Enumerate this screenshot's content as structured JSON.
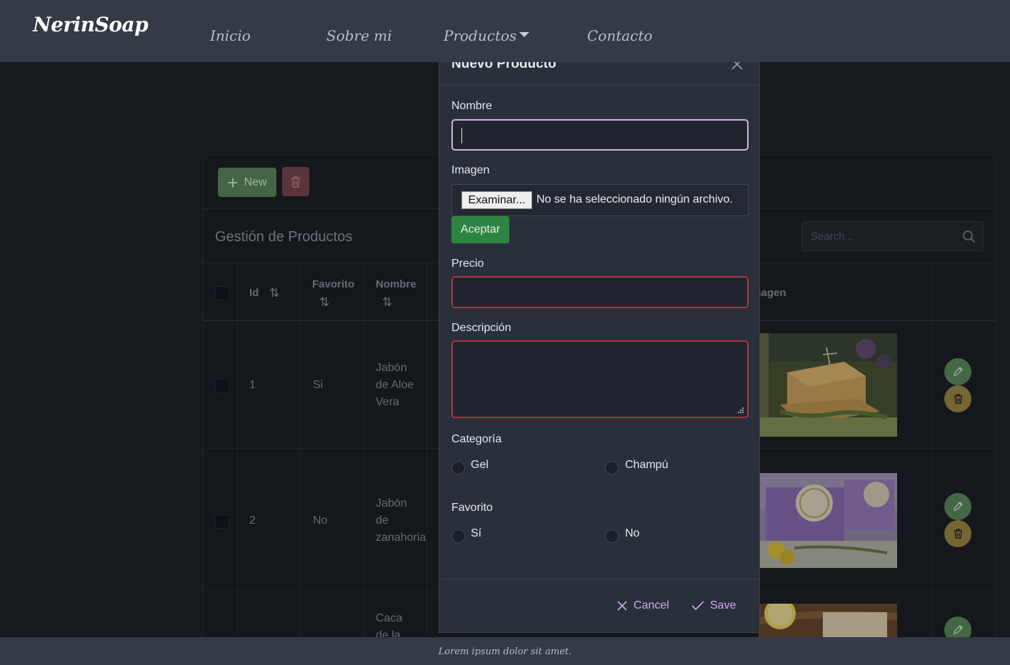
{
  "navbar": {
    "brand": "NerinSoap",
    "items": [
      "Inicio",
      "Sobre mi",
      "Productos",
      "Contacto"
    ]
  },
  "toolbar": {
    "new_label": "New"
  },
  "table": {
    "title": "Gestión de Productos",
    "search_placeholder": "Search...",
    "headers": {
      "id": "Id",
      "favorito": "Favorito",
      "nombre": "Nombre",
      "imagen": "Imagen"
    },
    "rows": [
      {
        "id": "1",
        "favorito": "Si",
        "nombre": [
          "Jabón",
          "de Aloe",
          "Vera"
        ]
      },
      {
        "id": "2",
        "favorito": "No",
        "nombre": [
          "Jabón",
          "de",
          "zanahoria"
        ]
      },
      {
        "id": "",
        "favorito": "",
        "nombre": [
          "Caca",
          "de la"
        ]
      }
    ]
  },
  "dialog": {
    "title": "Nuevo Producto",
    "nombre_label": "Nombre",
    "nombre_value": "",
    "imagen_label": "Imagen",
    "file_button": "Examinar...",
    "file_status": "No se ha seleccionado ningún archivo.",
    "aceptar": "Aceptar",
    "precio_label": "Precio",
    "descripcion_label": "Descripción",
    "categoria_label": "Categoría",
    "categoria_options": [
      "Gel",
      "Champú"
    ],
    "favorito_label": "Favorito",
    "favorito_options": [
      "Sí",
      "No"
    ],
    "cancel": "Cancel",
    "save": "Save"
  },
  "footer": {
    "text": "Lorem ipsum dolor sit amet."
  },
  "colors": {
    "accent": "#d2a8f0",
    "success": "#2e8543",
    "danger": "#a53a3f",
    "edit": "#5f8f62",
    "warning": "#a48d4a"
  }
}
